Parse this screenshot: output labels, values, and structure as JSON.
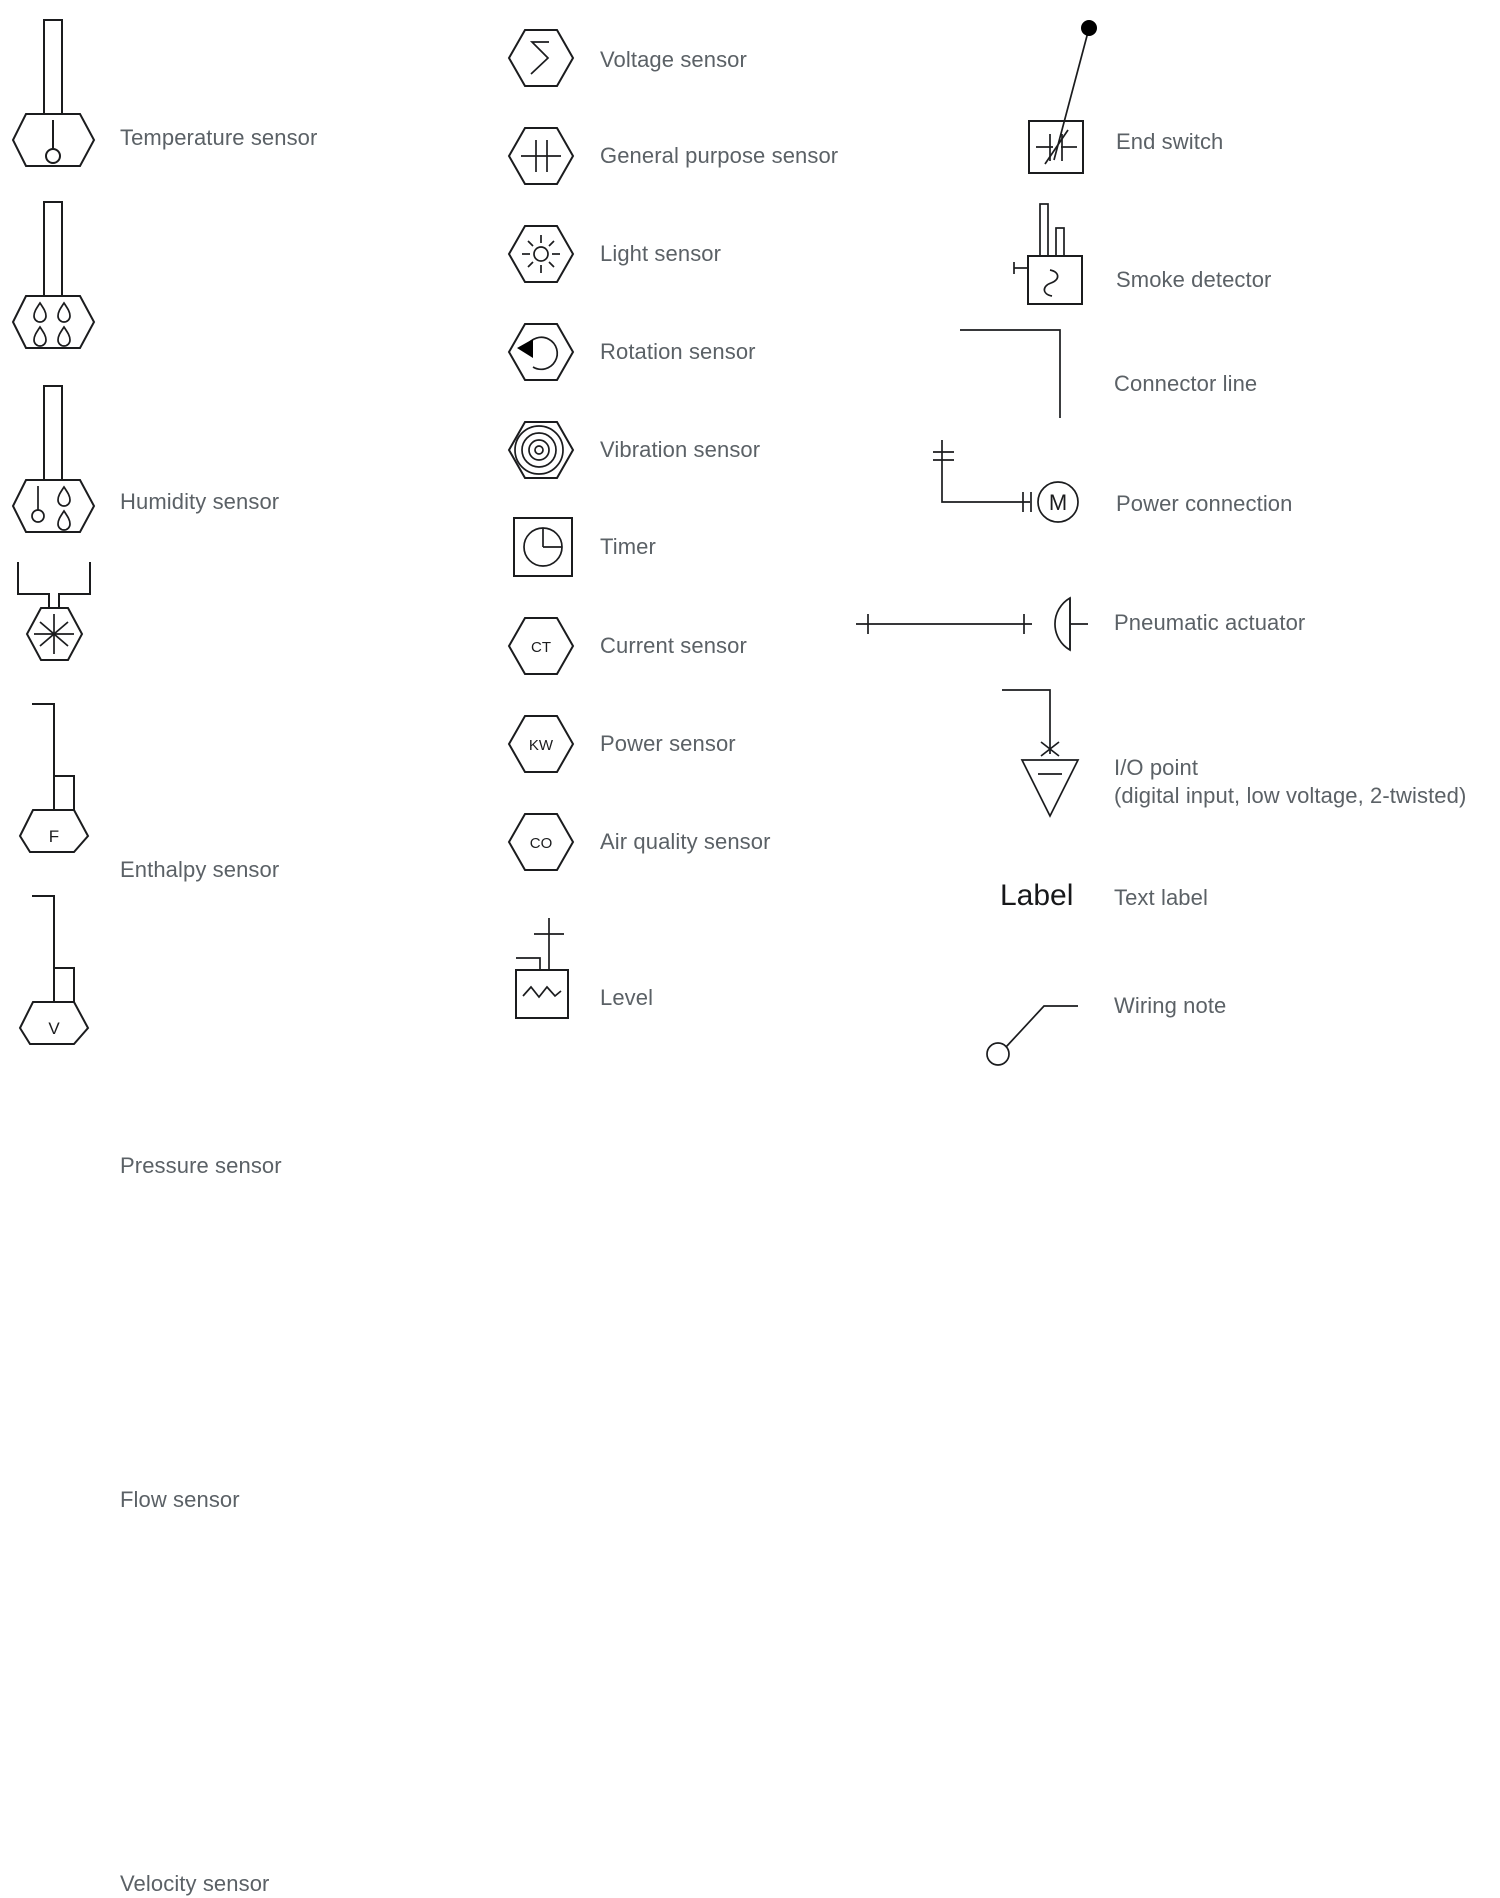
{
  "sheet": {
    "background_color": "#ffffff",
    "line_color": "#1b1c1e",
    "caption_color": "#5b6166",
    "label_text_color": "#17181a"
  },
  "columns": [
    {
      "name": "sensors-column",
      "items": [
        {
          "id": "temperature-sensor",
          "glyph": "hex-stem-thermo",
          "label": "Temperature sensor",
          "inner_text": ""
        },
        {
          "id": "humidity-sensor",
          "glyph": "hex-stem-humidity",
          "label": "Humidity sensor",
          "inner_text": ""
        },
        {
          "id": "enthalpy-sensor",
          "glyph": "hex-stem-enthalpy",
          "label": "Enthalpy sensor",
          "inner_text": ""
        },
        {
          "id": "pressure-sensor",
          "glyph": "hex-bracket-asterisk",
          "label": "Pressure sensor",
          "inner_text": ""
        },
        {
          "id": "flow-sensor",
          "glyph": "hex-duct-letter",
          "label": "Flow sensor",
          "inner_text": "F"
        },
        {
          "id": "velocity-sensor",
          "glyph": "hex-duct-letter",
          "label": "Velocity sensor",
          "inner_text": "V"
        }
      ]
    },
    {
      "name": "instruments-column",
      "items": [
        {
          "id": "voltage-sensor",
          "glyph": "hex-lightning",
          "label": "Voltage sensor",
          "inner_text": ""
        },
        {
          "id": "general-purpose-sensor",
          "glyph": "hex-capacitor",
          "label": "General purpose sensor",
          "inner_text": ""
        },
        {
          "id": "light-sensor",
          "glyph": "hex-sun",
          "label": "Light sensor",
          "inner_text": ""
        },
        {
          "id": "rotation-sensor",
          "glyph": "hex-rotation-arrow",
          "label": "Rotation sensor",
          "inner_text": ""
        },
        {
          "id": "vibration-sensor",
          "glyph": "hex-concentric",
          "label": "Vibration sensor",
          "inner_text": ""
        },
        {
          "id": "timer",
          "glyph": "square-pie-clock",
          "label": "Timer",
          "inner_text": ""
        },
        {
          "id": "current-sensor",
          "glyph": "hex-letters",
          "label": "Current sensor",
          "inner_text": "CT"
        },
        {
          "id": "power-sensor",
          "glyph": "hex-letters",
          "label": "Power sensor",
          "inner_text": "KW"
        },
        {
          "id": "air-quality-sensor",
          "glyph": "hex-letters",
          "label": "Air quality sensor",
          "inner_text": "CO"
        },
        {
          "id": "level",
          "glyph": "square-zigzag-tank",
          "label": "Level",
          "inner_text": ""
        }
      ]
    },
    {
      "name": "devices-column",
      "items": [
        {
          "id": "end-switch",
          "glyph": "square-switch-leader",
          "label": "End switch",
          "inner_text": ""
        },
        {
          "id": "smoke-detector",
          "glyph": "box-smoke",
          "label": "Smoke detector",
          "inner_text": ""
        },
        {
          "id": "connector-line",
          "glyph": "elbow-line",
          "label": "Connector line",
          "inner_text": ""
        },
        {
          "id": "power-connection",
          "glyph": "motor-feed",
          "label": "Power connection",
          "inner_text": "M"
        },
        {
          "id": "pneumatic-actuator",
          "glyph": "dome-actuator",
          "label": "Pneumatic actuator",
          "inner_text": ""
        },
        {
          "id": "io-point",
          "glyph": "triangle-io",
          "label": "I/O point\n(digital input, low voltage, 2-twisted)",
          "inner_text": ""
        },
        {
          "id": "text-label",
          "glyph": "text-sample",
          "label": "Text label",
          "inner_text": "Label"
        },
        {
          "id": "wiring-note",
          "glyph": "note-leader",
          "label": "Wiring note",
          "inner_text": ""
        }
      ]
    }
  ]
}
